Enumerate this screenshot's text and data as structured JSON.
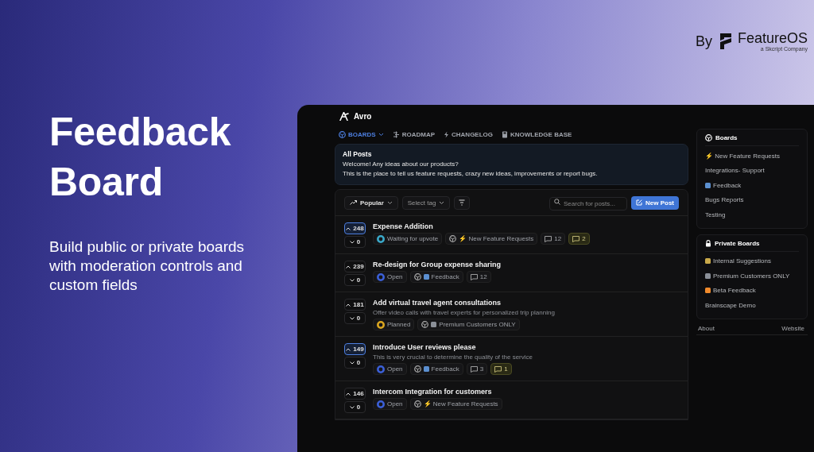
{
  "brand": {
    "by": "By",
    "name": "FeatureOS",
    "tagline": "a Skcript Company"
  },
  "hero": {
    "title": "Feedback Board",
    "subtitle": "Build public or private boards with moderation controls and custom fields"
  },
  "app": {
    "name": "Avro",
    "nav": [
      {
        "label": "BOARDS",
        "selected": true
      },
      {
        "label": "ROADMAP",
        "selected": false
      },
      {
        "label": "CHANGELOG",
        "selected": false
      },
      {
        "label": "KNOWLEDGE BASE",
        "selected": false
      }
    ],
    "intro": {
      "title": "All Posts",
      "lines": [
        "Welcome! Any ideas about our products?",
        "This is the place to tell us feature requests, crazy new ideas, improvements or report bugs."
      ]
    },
    "toolbar": {
      "sort": "Popular",
      "tag_placeholder": "Select tag",
      "search_placeholder": "Search for posts...",
      "new_post": "New Post"
    },
    "posts": [
      {
        "title": "Expense Addition",
        "upvotes": "248",
        "downvotes": "0",
        "voted": true,
        "tags": [
          {
            "kind": "status",
            "label": "Waiting for upvote",
            "color": "#3aa8c8"
          },
          {
            "kind": "board",
            "label": "⚡ New Feature Requests"
          },
          {
            "kind": "comments",
            "label": "12"
          },
          {
            "kind": "new_comments",
            "label": "2"
          }
        ]
      },
      {
        "title": "Re-design for Group expense sharing",
        "upvotes": "239",
        "downvotes": "0",
        "voted": false,
        "tags": [
          {
            "kind": "status",
            "label": "Open",
            "color": "#3b5fd6"
          },
          {
            "kind": "board",
            "label": "Feedback",
            "color": "#5b8fd0"
          },
          {
            "kind": "comments",
            "label": "12"
          }
        ]
      },
      {
        "title": "Add virtual travel agent consultations",
        "description": "Offer video calls with travel experts for personalized trip planning",
        "upvotes": "181",
        "downvotes": "0",
        "voted": false,
        "tags": [
          {
            "kind": "status",
            "label": "Planned",
            "color": "#d9a520"
          },
          {
            "kind": "board",
            "label": "Premium Customers ONLY",
            "color": "#8a8f98"
          }
        ]
      },
      {
        "title": "Introduce User reviews please",
        "description": "This is very crucial to determine the quality of the service",
        "upvotes": "149",
        "downvotes": "0",
        "voted": true,
        "tags": [
          {
            "kind": "status",
            "label": "Open",
            "color": "#3b5fd6"
          },
          {
            "kind": "board",
            "label": "Feedback",
            "color": "#5b8fd0"
          },
          {
            "kind": "comments",
            "label": "3"
          },
          {
            "kind": "new_comments",
            "label": "1"
          }
        ]
      },
      {
        "title": "Intercom Integration for customers",
        "upvotes": "146",
        "downvotes": "0",
        "voted": false,
        "tags": [
          {
            "kind": "status",
            "label": "Open",
            "color": "#3b5fd6"
          },
          {
            "kind": "board",
            "label": "⚡ New Feature Requests"
          }
        ]
      }
    ],
    "sidebar": [
      {
        "title": "Boards",
        "items": [
          {
            "label": "⚡ New Feature Requests"
          },
          {
            "label": "Integrations- Support"
          },
          {
            "label": "Feedback",
            "color": "#5b8fd0"
          },
          {
            "label": "Bugs Reports"
          },
          {
            "label": "Testing"
          }
        ]
      },
      {
        "title": "Private Boards",
        "items": [
          {
            "label": "Internal Suggestions",
            "color": "#c9a94a"
          },
          {
            "label": "Premium Customers ONLY",
            "color": "#8a8f98"
          },
          {
            "label": "Beta Feedback",
            "color": "#f08a2c"
          },
          {
            "label": "Brainscape Demo"
          }
        ]
      }
    ],
    "footer_links": [
      "About",
      "Website"
    ]
  }
}
